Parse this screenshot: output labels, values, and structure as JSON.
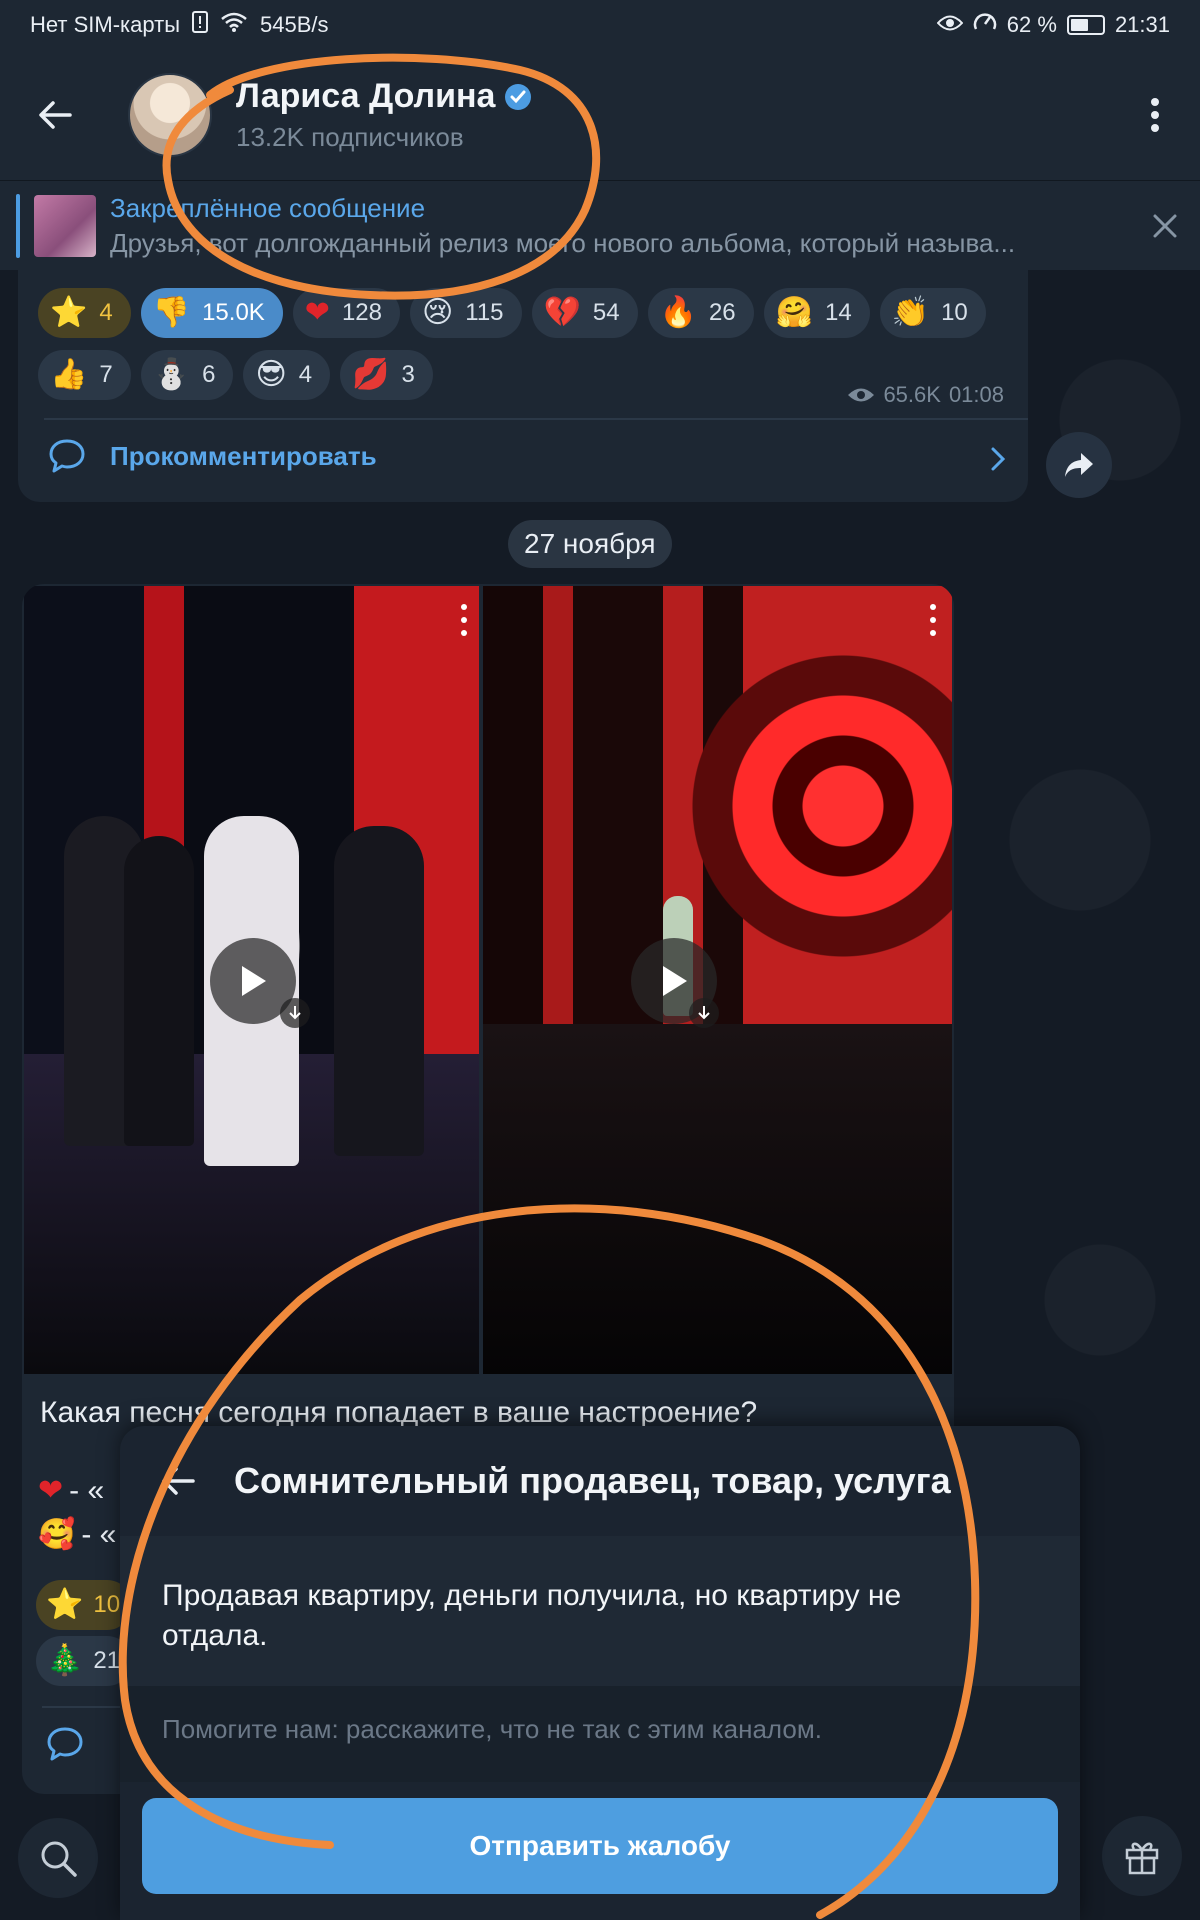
{
  "status_bar": {
    "carrier": "Нет SIM-карты",
    "net_speed": "545B/s",
    "battery": "62 %",
    "battery_level": 0.62,
    "time": "21:31"
  },
  "header": {
    "channel_name": "Лариса Долина",
    "subscribers": "13.2K подписчиков"
  },
  "pinned": {
    "title": "Закреплённое сообщение",
    "body": "Друзья, вот долгожданный релиз моего нового альбома, который называ..."
  },
  "prev_post": {
    "reactions": [
      {
        "emoji": "⭐",
        "count": "4",
        "kind": "star"
      },
      {
        "emoji": "👎",
        "count": "15.0K",
        "kind": "active"
      },
      {
        "emoji": "❤",
        "count": "128",
        "kind": "normal"
      },
      {
        "emoji": "😢",
        "count": "115",
        "kind": "normal"
      },
      {
        "emoji": "💔",
        "count": "54",
        "kind": "normal"
      },
      {
        "emoji": "🔥",
        "count": "26",
        "kind": "normal"
      },
      {
        "emoji": "🤗",
        "count": "14",
        "kind": "normal"
      },
      {
        "emoji": "👏",
        "count": "10",
        "kind": "normal"
      },
      {
        "emoji": "👍",
        "count": "7",
        "kind": "normal"
      },
      {
        "emoji": "⛄",
        "count": "6",
        "kind": "normal"
      },
      {
        "emoji": "😎",
        "count": "4",
        "kind": "normal"
      },
      {
        "emoji": "💋",
        "count": "3",
        "kind": "normal"
      }
    ],
    "views": "65.6K",
    "time": "01:08",
    "comment_label": "Прокомментировать"
  },
  "date_separator": "27 ноября",
  "media_post": {
    "caption": "Какая песня сегодня попадает в ваше настроение?",
    "lines": [
      {
        "emoji": "❤",
        "text": "- «"
      },
      {
        "emoji": "🥰",
        "text": "- «"
      }
    ],
    "reactions": [
      {
        "emoji": "⭐",
        "count": "10"
      },
      {
        "emoji": "🎄",
        "count": "21"
      }
    ]
  },
  "report_sheet": {
    "title": "Сомнительный продавец, товар, услуга",
    "message": "Продавая квартиру, деньги получила, но квартиру не отдала.",
    "input_placeholder": "Помогите нам: расскажите, что не так с этим каналом.",
    "submit_label": "Отправить жалобу"
  },
  "colors": {
    "accent": "#4e9ee0",
    "link": "#5aa7ea",
    "annotation": "#f08a3c",
    "surface": "#1d2733"
  }
}
